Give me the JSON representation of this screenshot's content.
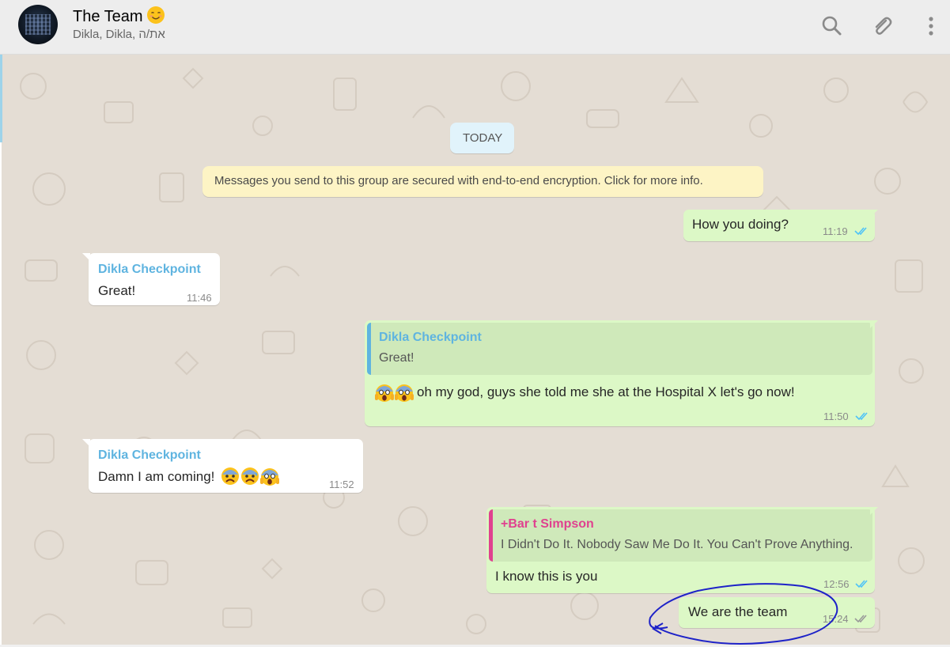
{
  "header": {
    "title": "The Team",
    "title_emoji": "smiling-face-emoji",
    "subtitle": "Dikla, Dikla, את/ה",
    "icons": [
      "search-icon",
      "attach-icon",
      "menu-icon"
    ]
  },
  "chat": {
    "date_label": "TODAY",
    "encryption_notice": "Messages you send to this group are secured with end-to-end encryption. Click for more info.",
    "messages": [
      {
        "direction": "out",
        "text": "How you doing?",
        "time": "11:19",
        "status": "read"
      },
      {
        "direction": "in",
        "sender": "Dikla Checkpoint",
        "text": "Great!",
        "time": "11:46"
      },
      {
        "direction": "out",
        "quote": {
          "name": "Dikla Checkpoint",
          "text": "Great!"
        },
        "text": "oh my god, guys she told me she at the Hospital X let's go now!",
        "emoji": [
          "scream-emoji",
          "scream-emoji"
        ],
        "time": "11:50",
        "status": "read"
      },
      {
        "direction": "in",
        "sender": "Dikla Checkpoint",
        "text": "Damn I am coming!",
        "emoji": [
          "fearful-face-emoji",
          "anxious-face-emoji",
          "scream-emoji"
        ],
        "time": "11:52"
      },
      {
        "direction": "out",
        "quote": {
          "name": "+Bar t Simpson",
          "text": "I Didn't Do It. Nobody Saw Me Do It. You Can't Prove Anything."
        },
        "text": "I know this is you",
        "time": "12:56",
        "status": "read"
      },
      {
        "direction": "out",
        "text": "We are the team",
        "time": "15:24",
        "status": "delivered"
      }
    ]
  },
  "colors": {
    "outgoing_bubble": "#dcf8c6",
    "incoming_bubble": "#ffffff",
    "sender_blue": "#5fb4e0",
    "sender_pink": "#e0418f",
    "tick_read": "#4fc3f7",
    "tick_delivered": "#999999",
    "annotation": "#1e22c8",
    "date_chip": "#e1f3fb",
    "notice": "#fdf4c5"
  }
}
